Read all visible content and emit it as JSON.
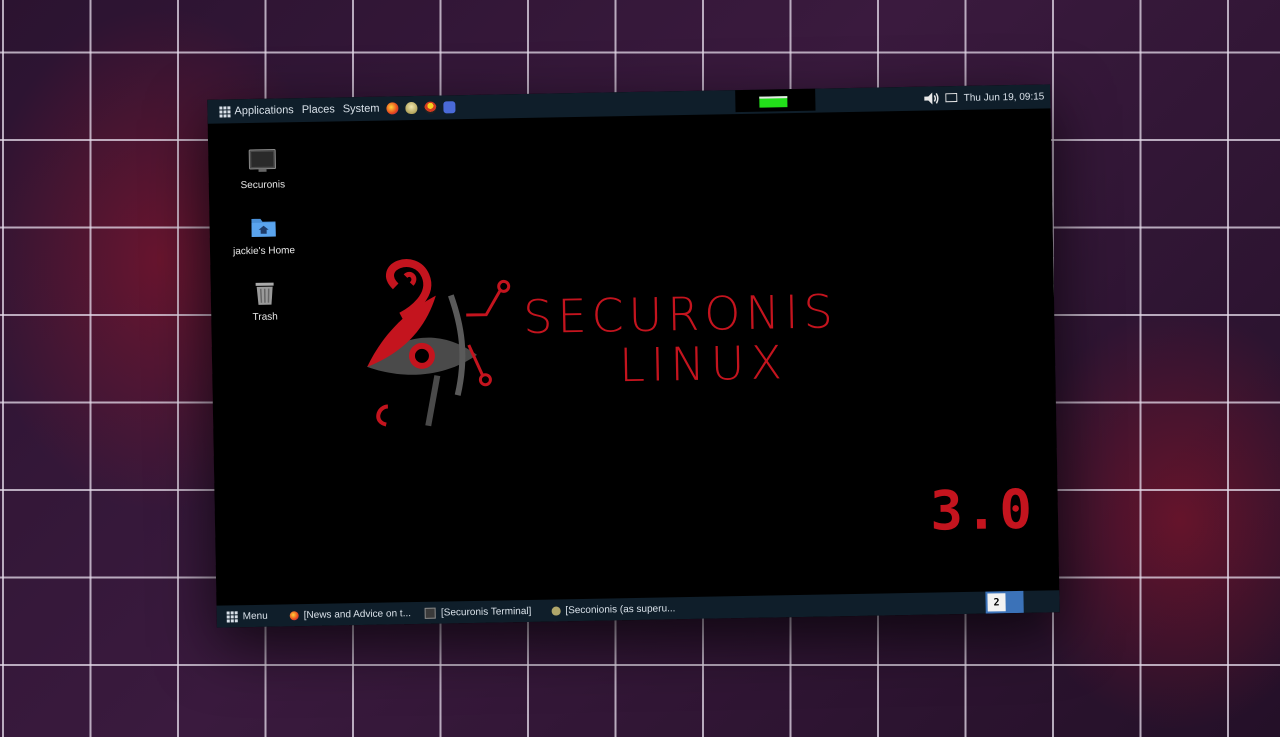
{
  "top_panel": {
    "applications_label": "Applications",
    "places_label": "Places",
    "system_label": "System",
    "launchers": [
      "firefox-icon",
      "tor-onion-icon",
      "tux-icon",
      "lock-icon"
    ],
    "clock": "Thu Jun 19, 09:15"
  },
  "desktop": {
    "icons": [
      {
        "label": "Securonis",
        "icon": "monitor-icon"
      },
      {
        "label": "jackie's Home",
        "icon": "home-folder-icon"
      },
      {
        "label": "Trash",
        "icon": "trash-icon"
      }
    ]
  },
  "brand": {
    "line1": "SECURONIS",
    "line2": "LINUX",
    "version": "3.0"
  },
  "taskbar": {
    "menu_label": "Menu",
    "tasks": [
      {
        "label": "[News and Advice on t...",
        "icon": "firefox-icon"
      },
      {
        "label": "[Securonis Terminal]",
        "icon": "terminal-icon"
      },
      {
        "label": "[Seconionis (as superu...",
        "icon": "onion-icon"
      }
    ],
    "workspace": "2"
  },
  "colors": {
    "accent_red": "#c4141e",
    "panel": "#0f1e2a",
    "battery": "#22e01a"
  }
}
